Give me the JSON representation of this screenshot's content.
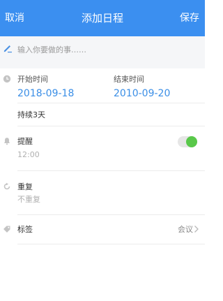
{
  "nav": {
    "cancel": "取消",
    "title": "添加日程",
    "save": "保存"
  },
  "input": {
    "placeholder": "输入你要做的事……",
    "value": ""
  },
  "time": {
    "start_label": "开始时间",
    "start_value": "2018-09-18",
    "end_label": "结束时间",
    "end_value": "2010-09-20",
    "duration": "持续3天"
  },
  "reminder": {
    "label": "提醒",
    "value": "12:00",
    "enabled": true
  },
  "repeat": {
    "label": "重复",
    "value": "不重复"
  },
  "tag": {
    "label": "标签",
    "value": "会议"
  },
  "colors": {
    "nav": "#3b8ff0",
    "accent": "#3a8ee6",
    "toggle_on": "#59c84a"
  }
}
